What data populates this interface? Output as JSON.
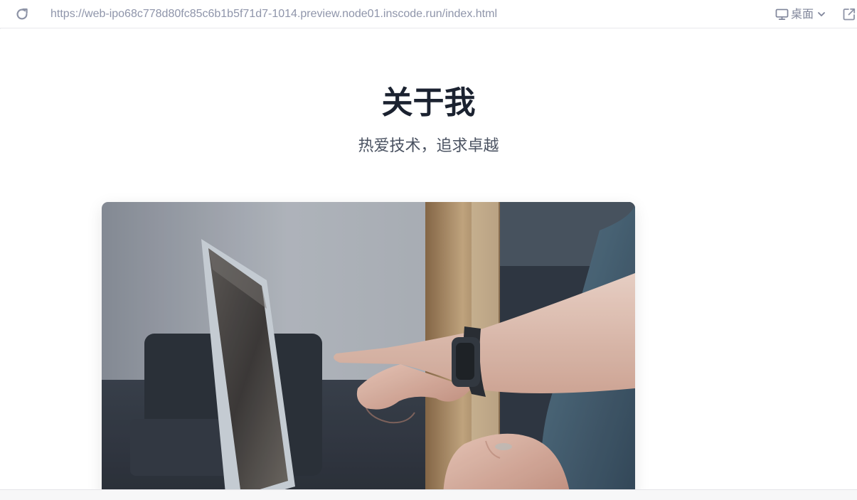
{
  "browser": {
    "url": "https://web-ipo68c778d80fc85c6b1b5f71d7-1014.preview.node01.inscode.run/index.html",
    "device_label": "桌面",
    "icons": {
      "reload": "reload-icon",
      "device": "monitor-icon",
      "dropdown": "chevron-down-icon",
      "external": "open-external-icon"
    }
  },
  "page": {
    "title": "关于我",
    "subtitle": "热爱技术，追求卓越"
  },
  "colors": {
    "title": "#1b2230",
    "subtitle": "#4a5261",
    "toolbar_text": "#8f95aa"
  }
}
